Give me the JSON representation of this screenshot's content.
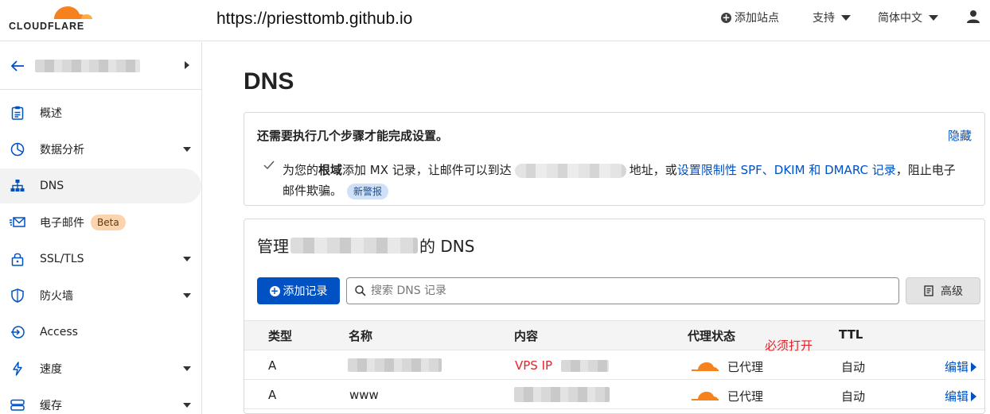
{
  "topbar": {
    "logo_text": "CLOUDFLARE",
    "url": "https://priesttomb.github.io",
    "add_site": "添加站点",
    "support": "支持",
    "language": "简体中文"
  },
  "sidebar": {
    "items": [
      {
        "label": "概述",
        "icon": "clipboard-icon"
      },
      {
        "label": "数据分析",
        "icon": "pie-chart-icon"
      },
      {
        "label": "DNS",
        "icon": "network-icon"
      },
      {
        "label": "电子邮件",
        "icon": "email-icon",
        "badge": "Beta"
      },
      {
        "label": "SSL/TLS",
        "icon": "lock-icon"
      },
      {
        "label": "防火墙",
        "icon": "shield-icon"
      },
      {
        "label": "Access",
        "icon": "access-icon"
      },
      {
        "label": "速度",
        "icon": "bolt-icon"
      },
      {
        "label": "缓存",
        "icon": "storage-icon"
      }
    ]
  },
  "main": {
    "title": "DNS",
    "setup": {
      "title": "还需要执行几个步骤才能完成设置。",
      "hide": "隐藏",
      "text_1": "为您的",
      "text_bold": "根域",
      "text_2": "添加 MX 记录，让邮件可以到达",
      "text_3": "地址，或",
      "link": "设置限制性 SPF、DKIM 和 DMARC 记录",
      "text_4": "，阻止电子邮件欺骗。",
      "tag": "新警报"
    },
    "dns": {
      "title_prefix": "管理",
      "title_suffix": "的 DNS",
      "add_record": "添加记录",
      "search_placeholder": "搜索 DNS 记录",
      "advanced": "高级",
      "annotation": "必须打开",
      "columns": [
        "类型",
        "名称",
        "内容",
        "代理状态",
        "TTL"
      ],
      "rows": [
        {
          "type": "A",
          "name": "",
          "content": "VPS IP",
          "proxy": "已代理",
          "ttl": "自动",
          "edit": "编辑"
        },
        {
          "type": "A",
          "name": "www",
          "content": "",
          "proxy": "已代理",
          "ttl": "自动",
          "edit": "编辑"
        }
      ]
    }
  },
  "colors": {
    "accent": "#0051c3",
    "brand_orange": "#f6821f",
    "annotation_red": "#e0242a",
    "beta_bg": "#fbd4ae"
  }
}
